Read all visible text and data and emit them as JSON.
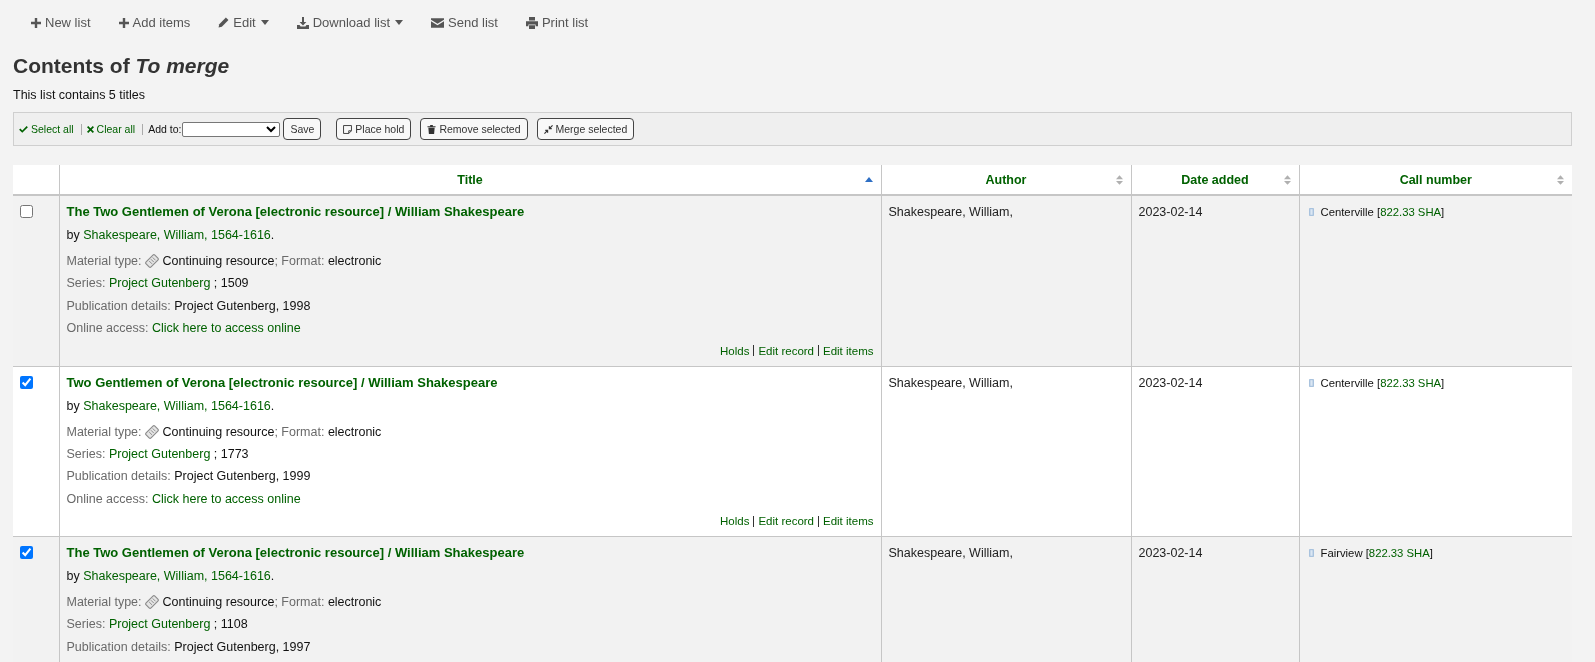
{
  "toolbar": [
    {
      "kind": "new",
      "label": "New list",
      "has_menu": false
    },
    {
      "kind": "add",
      "label": "Add items",
      "has_menu": false
    },
    {
      "kind": "edit",
      "label": "Edit",
      "has_menu": true
    },
    {
      "kind": "download",
      "label": "Download list",
      "has_menu": true
    },
    {
      "kind": "send",
      "label": "Send list",
      "has_menu": false
    },
    {
      "kind": "print",
      "label": "Print list",
      "has_menu": false
    }
  ],
  "heading": "Contents of *To merge*",
  "summary": "This list contains 5 titles",
  "selection_bar": {
    "select_all": "Select all",
    "clear_all": "Clear all",
    "add_to_label": "Add to:",
    "save": "Save",
    "buttons": [
      {
        "kind": "hold",
        "label": "Place hold"
      },
      {
        "kind": "remove",
        "label": "Remove selected"
      },
      {
        "kind": "merge",
        "label": "Merge selected"
      }
    ]
  },
  "table": {
    "columns": [
      {
        "label": "Title",
        "sorted": true
      },
      {
        "label": "Author",
        "sorted": false
      },
      {
        "label": "Date added",
        "sorted": false
      },
      {
        "label": "Call number",
        "sorted": false
      }
    ],
    "rows": [
      {
        "selected": false,
        "title": "The Two Gentlemen of Verona [electronic resource] / William Shakespeare",
        "by": "by",
        "author_link": "Shakespeare, William, 1564-1616",
        "by_end": ".",
        "material_label": "Material type:",
        "material": "Continuing resource",
        "format_label": "; Format:",
        "format": "electronic",
        "series_label": "Series:",
        "series": "Project Gutenberg",
        "series_number": "; 1509",
        "publication_label": "Publication details:",
        "publication": "Project Gutenberg, 1998",
        "online_label": "Online access:",
        "online_link": "Click here to access online",
        "links": [
          "Holds",
          "Edit record",
          "Edit items"
        ],
        "author": "Shakespeare, William,",
        "date_added": "2023-02-14",
        "holdings": [
          {
            "library": "Centerville",
            "open": "[",
            "call_number": "822.33 SHA",
            "close": "]"
          }
        ]
      },
      {
        "selected": true,
        "title": "Two Gentlemen of Verona [electronic resource] / William Shakespeare",
        "by": "by",
        "author_link": "Shakespeare, William, 1564-1616",
        "by_end": ".",
        "material_label": "Material type:",
        "material": "Continuing resource",
        "format_label": "; Format:",
        "format": "electronic",
        "series_label": "Series:",
        "series": "Project Gutenberg",
        "series_number": "; 1773",
        "publication_label": "Publication details:",
        "publication": "Project Gutenberg, 1999",
        "online_label": "Online access:",
        "online_link": "Click here to access online",
        "links": [
          "Holds",
          "Edit record",
          "Edit items"
        ],
        "author": "Shakespeare, William,",
        "date_added": "2023-02-14",
        "holdings": [
          {
            "library": "Centerville",
            "open": "[",
            "call_number": "822.33 SHA",
            "close": "]"
          }
        ]
      },
      {
        "selected": true,
        "title": "The Two Gentlemen of Verona [electronic resource] / William Shakespeare",
        "by": "by",
        "author_link": "Shakespeare, William, 1564-1616",
        "by_end": ".",
        "material_label": "Material type:",
        "material": "Continuing resource",
        "format_label": "; Format:",
        "format": "electronic",
        "series_label": "Series:",
        "series": "Project Gutenberg",
        "series_number": "; 1108",
        "publication_label": "Publication details:",
        "publication": "Project Gutenberg, 1997",
        "author": "Shakespeare, William,",
        "date_added": "2023-02-14",
        "holdings": [
          {
            "library": "Fairview",
            "open": "[",
            "call_number": "822.33 SHA",
            "close": "]"
          }
        ]
      }
    ]
  }
}
